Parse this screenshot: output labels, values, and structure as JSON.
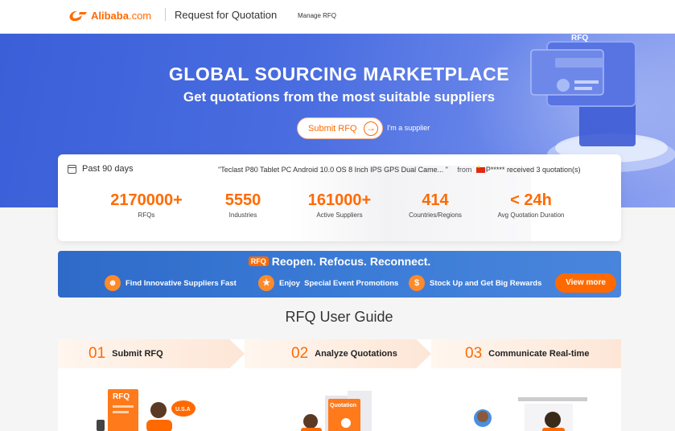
{
  "header": {
    "logo_text": "Alibaba",
    "logo_suffix": ".com",
    "page_title": "Request for Quotation",
    "manage_link": "Manage RFQ"
  },
  "hero": {
    "title": "GLOBAL SOURCING MARKETPLACE",
    "subtitle": "Get quotations from the most suitable suppliers",
    "submit_label": "Submit RFQ",
    "supplier_link": "I'm a supplier",
    "illustration_label": "RFQ"
  },
  "stats": {
    "period": "Past 90 days",
    "ticker_quote": "\"Teclast P80 Tablet PC Android 10.0 OS 8 Inch IPS GPS Dual Came... \"",
    "ticker_from": "from",
    "ticker_buyer": "P*****",
    "ticker_result": "received 3 quotation(s)",
    "items": [
      {
        "value": "2170000+",
        "label": "RFQs"
      },
      {
        "value": "5550",
        "label": "Industries"
      },
      {
        "value": "161000+",
        "label": "Active Suppliers"
      },
      {
        "value": "414",
        "label": "Countries/Regions"
      },
      {
        "value": "< 24h",
        "label": "Avg Quotation Duration"
      }
    ]
  },
  "promo": {
    "tag": "RFQ",
    "headline": "Reopen. Refocus. Reconnect.",
    "items": [
      {
        "icon": "people-icon",
        "label": "Find Innovative Suppliers Fast"
      },
      {
        "icon": "tag-icon",
        "label": "Enjoy  Special Event Promotions"
      },
      {
        "icon": "dollar-icon",
        "label": "Stock Up and Get Big Rewards"
      }
    ],
    "cta": "View more"
  },
  "guide": {
    "title": "RFQ User Guide",
    "steps": [
      {
        "num": "01",
        "label": "Submit RFQ"
      },
      {
        "num": "02",
        "label": "Analyze Quotations"
      },
      {
        "num": "03",
        "label": "Communicate Real-time"
      }
    ],
    "scene_labels": {
      "rfq_card": "RFQ",
      "speech": "U.S.A",
      "quotation_card": "Quotation"
    }
  },
  "colors": {
    "accent": "#ff6a00",
    "hero_blue": "#4a6de0",
    "promo_blue": "#3a7bd6"
  }
}
